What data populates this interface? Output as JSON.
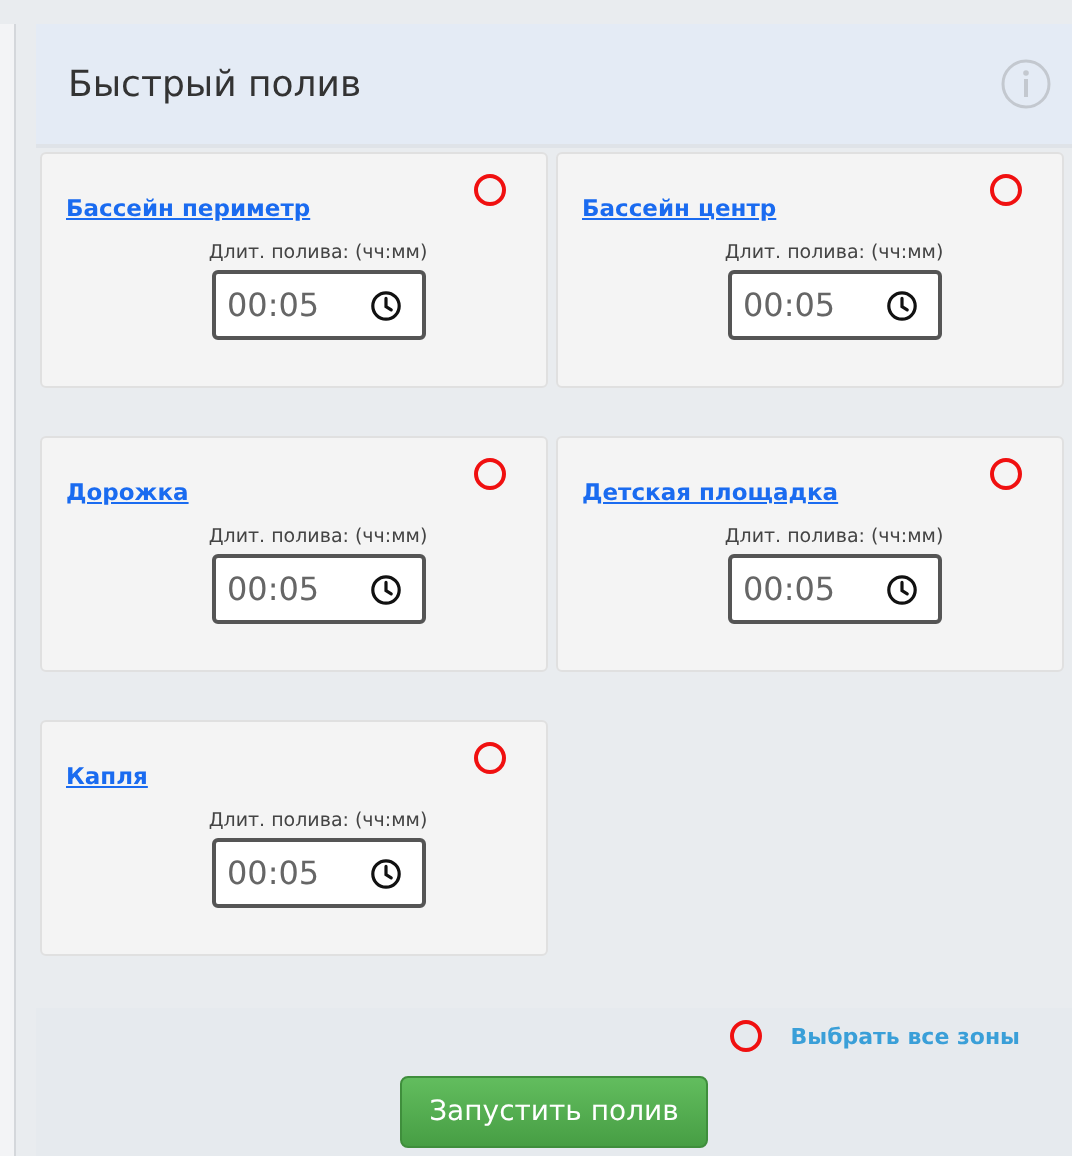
{
  "panel": {
    "title": "Быстрый полив"
  },
  "zones": [
    {
      "name": "Бассейн периметр",
      "duration_label": "Длит. полива: (чч:мм)",
      "value": "00:05",
      "selected": false
    },
    {
      "name": "Бассейн центр",
      "duration_label": "Длит. полива: (чч:мм)",
      "value": "00:05",
      "selected": false
    },
    {
      "name": "Дорожка",
      "duration_label": "Длит. полива: (чч:мм)",
      "value": "00:05",
      "selected": false
    },
    {
      "name": "Детская площадка",
      "duration_label": "Длит. полива: (чч:мм)",
      "value": "00:05",
      "selected": false
    },
    {
      "name": "Капля",
      "duration_label": "Длит. полива: (чч:мм)",
      "value": "00:05",
      "selected": false
    }
  ],
  "select_all": {
    "label": "Выбрать все зоны",
    "selected": false
  },
  "start_button": "Запустить полив"
}
